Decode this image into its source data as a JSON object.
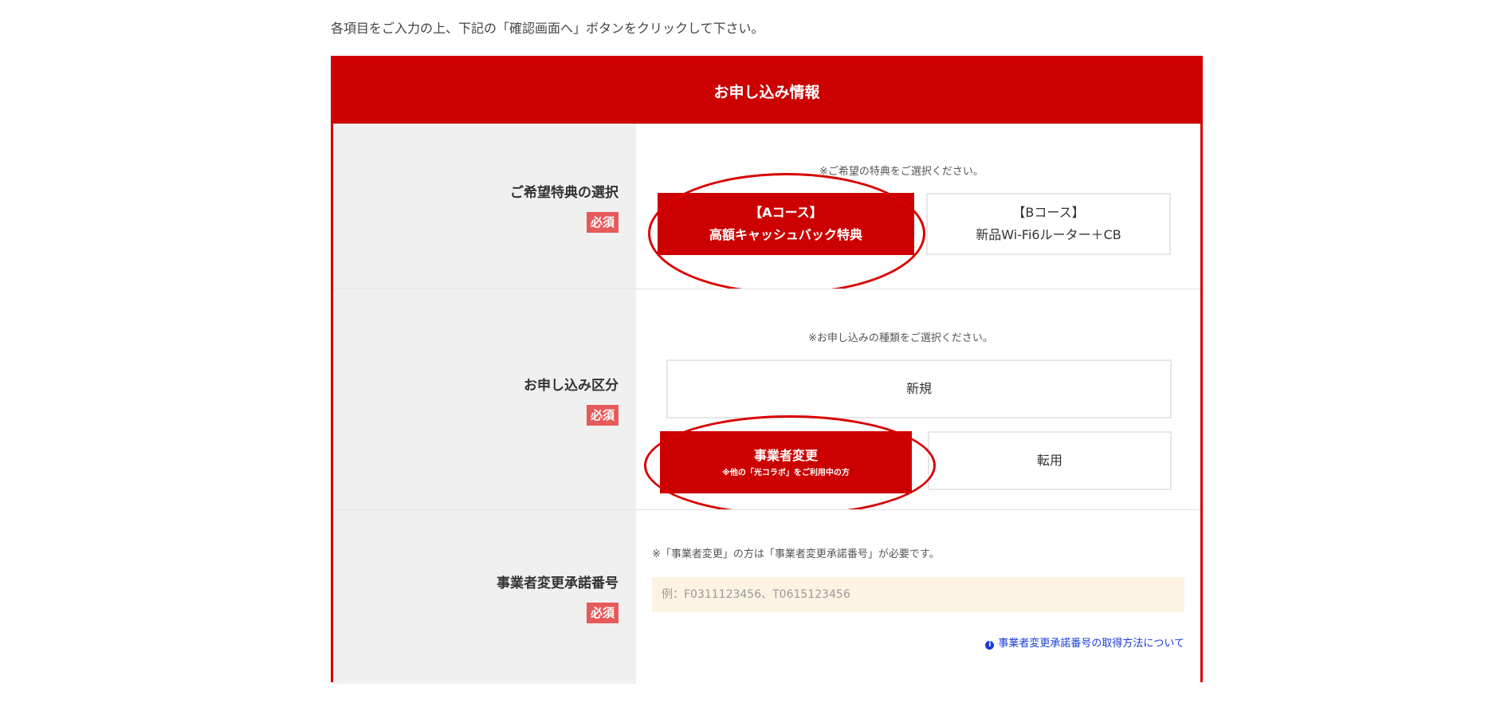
{
  "intro_text": "各項目をご入力の上、下記の「確認画面へ」ボタンをクリックして下さい。",
  "form": {
    "header": "お申し込み情報",
    "required_badge": "必須",
    "benefit": {
      "label": "ご希望特典の選択",
      "note": "※ご希望の特典をご選択ください。",
      "option_a": {
        "line1": "【Aコース】",
        "line2": "高額キャッシュバック特典",
        "selected": true
      },
      "option_b": {
        "line1": "【Bコース】",
        "line2": "新品Wi-Fi6ルーター＋CB",
        "selected": false
      }
    },
    "application_type": {
      "label": "お申し込み区分",
      "note": "※お申し込みの種類をご選択ください。",
      "option_new": {
        "label": "新規",
        "selected": false
      },
      "option_change": {
        "label": "事業者変更",
        "sub": "※他の「光コラボ」をご利用中の方",
        "selected": true
      },
      "option_transfer": {
        "label": "転用",
        "selected": false
      }
    },
    "consent_number": {
      "label": "事業者変更承諾番号",
      "note": "※「事業者変更」の方は「事業者変更承諾番号」が必要です。",
      "placeholder": "例：F0311123456、T0615123456",
      "value": "",
      "help_link": "事業者変更承諾番号の取得方法について",
      "help_icon": "info-icon"
    }
  },
  "colors": {
    "accent": "#cc0000",
    "badge": "#e65a5a",
    "label_bg": "#f0f0f0",
    "input_bg": "#fdf3e2",
    "link": "#1a3dd8"
  }
}
